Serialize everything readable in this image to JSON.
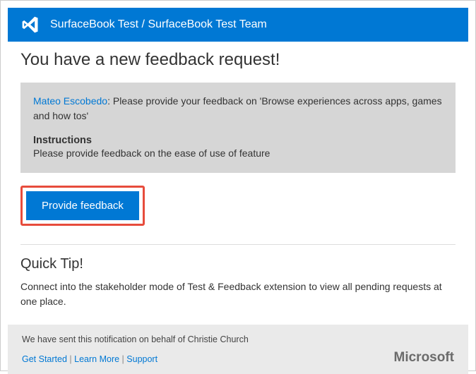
{
  "header": {
    "title": "SurfaceBook Test / SurfaceBook Test Team"
  },
  "main": {
    "heading": "You have a new feedback request!",
    "requester_name": "Mateo Escobedo",
    "requester_suffix": ": ",
    "request_text": "Please provide your feedback on 'Browse experiences across  apps, games and how tos'",
    "instructions_heading": "Instructions",
    "instructions_text": "Please provide feedback on the ease of use of feature",
    "button_label": "Provide feedback"
  },
  "quicktip": {
    "heading": "Quick Tip!",
    "text": "Connect into the stakeholder mode of Test & Feedback extension to view all pending requests at one place."
  },
  "footer": {
    "sent_prefix": "We have sent this notification on behalf of  ",
    "sent_name": "Christie Church",
    "links": {
      "get_started": "Get Started",
      "learn_more": "Learn More",
      "support": "Support"
    },
    "brand": "Microsoft"
  }
}
